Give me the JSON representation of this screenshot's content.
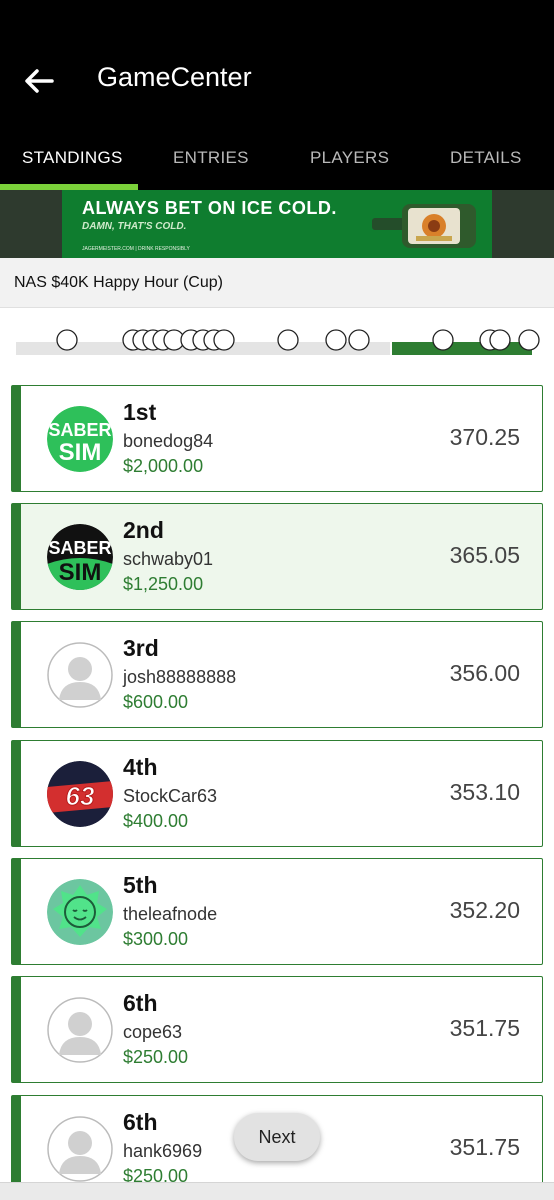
{
  "app": {
    "title": "GameCenter"
  },
  "tabs": [
    {
      "label": "STANDINGS",
      "active": true
    },
    {
      "label": "ENTRIES",
      "active": false
    },
    {
      "label": "PLAYERS",
      "active": false
    },
    {
      "label": "DETAILS",
      "active": false
    }
  ],
  "ad": {
    "headline": "ALWAYS BET ON ICE COLD.",
    "subline": "DAMN, THAT'S COLD.",
    "fine_print": "JAGERMEISTER.COM | DRINK RESPONSIBLY"
  },
  "contest": {
    "name": "NAS $40K Happy Hour (Cup)"
  },
  "timeline": {
    "progress_fraction": 0.25
  },
  "standings": [
    {
      "rank": "1st",
      "user": "bonedog84",
      "prize": "$2,000.00",
      "score": "370.25",
      "avatar": "sabersim-green-avatar",
      "highlight": false
    },
    {
      "rank": "2nd",
      "user": "schwaby01",
      "prize": "$1,250.00",
      "score": "365.05",
      "avatar": "sabersim-dark-avatar",
      "highlight": true
    },
    {
      "rank": "3rd",
      "user": "josh88888888",
      "prize": "$600.00",
      "score": "356.00",
      "avatar": "default-user-avatar",
      "highlight": false
    },
    {
      "rank": "4th",
      "user": "StockCar63",
      "prize": "$400.00",
      "score": "353.10",
      "avatar": "car-63-avatar",
      "highlight": false
    },
    {
      "rank": "5th",
      "user": "theleafnode",
      "prize": "$300.00",
      "score": "352.20",
      "avatar": "leaf-face-avatar",
      "highlight": false
    },
    {
      "rank": "6th",
      "user": "cope63",
      "prize": "$250.00",
      "score": "351.75",
      "avatar": "default-user-avatar",
      "highlight": false
    },
    {
      "rank": "6th",
      "user": "hank6969",
      "prize": "$250.00",
      "score": "351.75",
      "avatar": "default-user-avatar",
      "highlight": false
    }
  ],
  "next_button": {
    "label": "Next"
  },
  "colors": {
    "accent": "#7bd13a",
    "success": "#2e7d32",
    "appbar": "#000000"
  }
}
